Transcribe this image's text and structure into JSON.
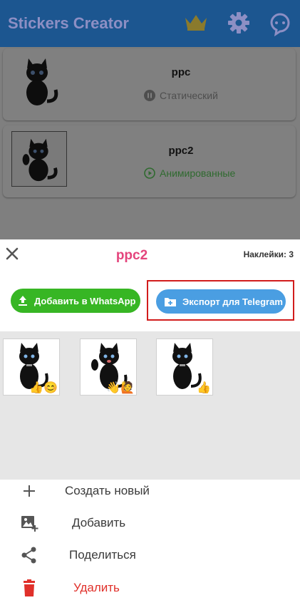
{
  "app": {
    "title": "Stickers Creator",
    "icons": [
      "crown-icon",
      "gear-icon",
      "chat-bot-icon"
    ]
  },
  "packs": [
    {
      "name": "ppc",
      "type_label": "Статический",
      "type_icon": "pause-icon"
    },
    {
      "name": "ppc2",
      "type_label": "Анимированные",
      "type_icon": "play-icon"
    }
  ],
  "sheet": {
    "title": "ppc2",
    "count_label": "Наклейки: 3",
    "whatsapp_button": "Добавить в WhatsApp",
    "telegram_button": "Экспорт для Telegram",
    "stickers": [
      {
        "emoji": "👍😊"
      },
      {
        "emoji": "👋🙋"
      },
      {
        "emoji": "👍"
      }
    ],
    "menu": {
      "create_new": "Создать новый",
      "add": "Добавить",
      "share": "Поделиться",
      "delete": "Удалить"
    }
  },
  "colors": {
    "accent_pink": "#e4447c",
    "whatsapp_green": "#37b624",
    "telegram_blue": "#4a9ee2",
    "delete_red": "#e0302a",
    "highlight_red": "#d21c1c"
  }
}
